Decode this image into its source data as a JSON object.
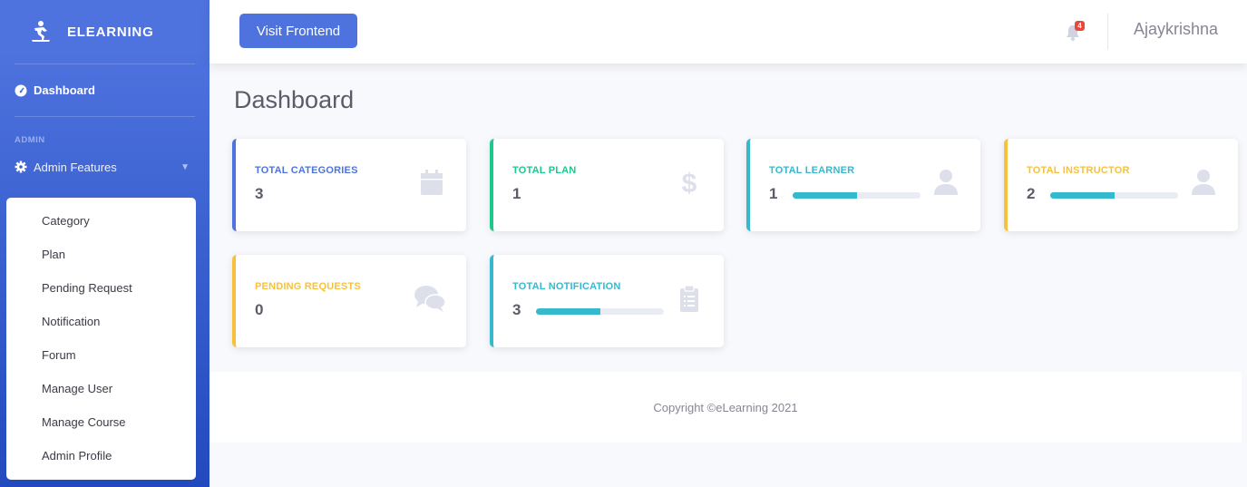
{
  "brand": {
    "name": "ELEARNING"
  },
  "sidebar": {
    "dashboard_label": "Dashboard",
    "heading": "ADMIN",
    "features_label": "Admin Features",
    "submenu": [
      "Category",
      "Plan",
      "Pending Request",
      "Notification",
      "Forum",
      "Manage User",
      "Manage Course",
      "Admin Profile"
    ]
  },
  "topbar": {
    "visit_button": "Visit Frontend",
    "notification_count": "4",
    "username": "Ajaykrishna"
  },
  "page": {
    "title": "Dashboard"
  },
  "cards": [
    {
      "label": "TOTAL CATEGORIES",
      "value": "3",
      "color": "#4e73df",
      "icon": "calendar-icon"
    },
    {
      "label": "TOTAL PLAN",
      "value": "1",
      "color": "#1cc88a",
      "icon": "dollar-icon"
    },
    {
      "label": "TOTAL LEARNER",
      "value": "1",
      "color": "#36b9cc",
      "icon": "user-icon",
      "progress": 0.5
    },
    {
      "label": "TOTAL INSTRUCTOR",
      "value": "2",
      "color": "#f6c23e",
      "icon": "user-icon",
      "progress": 0.5
    },
    {
      "label": "PENDING REQUESTS",
      "value": "0",
      "color": "#f6c23e",
      "icon": "comments-icon"
    },
    {
      "label": "TOTAL NOTIFICATION",
      "value": "3",
      "color": "#36b9cc",
      "icon": "clipboard-icon",
      "progress": 0.5
    }
  ],
  "footer": {
    "copyright": "Copyright ©eLearning 2021"
  }
}
